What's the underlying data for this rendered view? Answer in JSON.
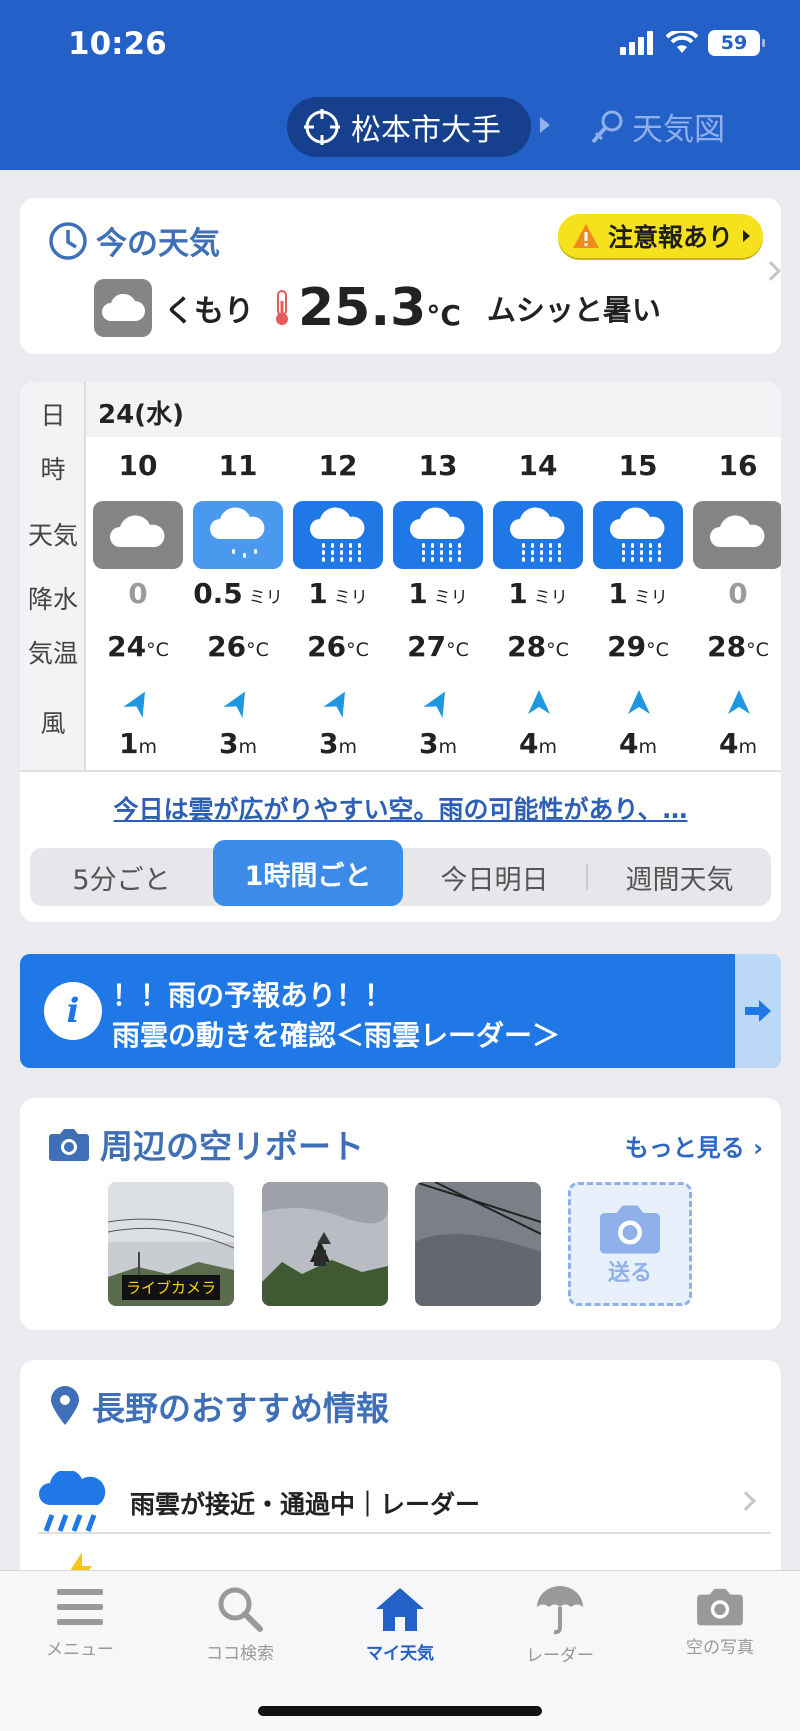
{
  "status_bar": {
    "time": "10:26",
    "battery": "59"
  },
  "header": {
    "location": "松本市大手",
    "weather_map_label": "天気図"
  },
  "now": {
    "title": "今の天気",
    "warning_badge": "注意報あり",
    "condition": "くもり",
    "temperature": "25.3",
    "temp_unit": "°C",
    "feel": "ムシッと暑い"
  },
  "forecast": {
    "row_labels": {
      "day": "日",
      "hour": "時",
      "weather": "天気",
      "precip": "降水",
      "temp": "気温",
      "wind": "風"
    },
    "date": "24(水)",
    "precip_unit": "ミリ",
    "temp_unit": "°C",
    "wind_unit": "m",
    "hours": [
      {
        "hour": "10",
        "weather_icon": "cloud-icon",
        "precip": "0",
        "temp": "24",
        "wind": "1"
      },
      {
        "hour": "11",
        "weather_icon": "light-rain-icon",
        "precip": "0.5",
        "temp": "26",
        "wind": "3"
      },
      {
        "hour": "12",
        "weather_icon": "rain-icon",
        "precip": "1",
        "temp": "26",
        "wind": "3"
      },
      {
        "hour": "13",
        "weather_icon": "rain-icon",
        "precip": "1",
        "temp": "27",
        "wind": "3"
      },
      {
        "hour": "14",
        "weather_icon": "rain-icon",
        "precip": "1",
        "temp": "28",
        "wind": "4"
      },
      {
        "hour": "15",
        "weather_icon": "rain-icon",
        "precip": "1",
        "temp": "29",
        "wind": "4"
      },
      {
        "hour": "16",
        "weather_icon": "cloud-icon",
        "precip": "0",
        "temp": "28",
        "wind": "4"
      }
    ],
    "summary": "今日は雲が広がりやすい空。雨の可能性があり、…",
    "tabs": [
      "5分ごと",
      "1時間ごと",
      "今日明日",
      "週間天気"
    ],
    "active_tab": "1時間ごと"
  },
  "alert": {
    "line1": "！！雨の予報あり！！",
    "line2": "雨雲の動きを確認＜雨雲レーダー＞"
  },
  "sky_report": {
    "title": "周辺の空リポート",
    "more_label": "もっと見る",
    "live_camera_label": "ライブカメラ",
    "send_label": "送る"
  },
  "recommend": {
    "title": "長野のおすすめ情報",
    "item1": "雨雲が接近・通過中｜レーダー"
  },
  "tabbar": {
    "menu": "メニュー",
    "search": "ココ検索",
    "my_weather": "マイ天気",
    "radar": "レーダー",
    "sky_photos": "空の写真"
  },
  "colors": {
    "header": "#2360c8",
    "accent": "#3d8be8",
    "warning": "#f5e21d",
    "alert": "#1f78e6"
  }
}
